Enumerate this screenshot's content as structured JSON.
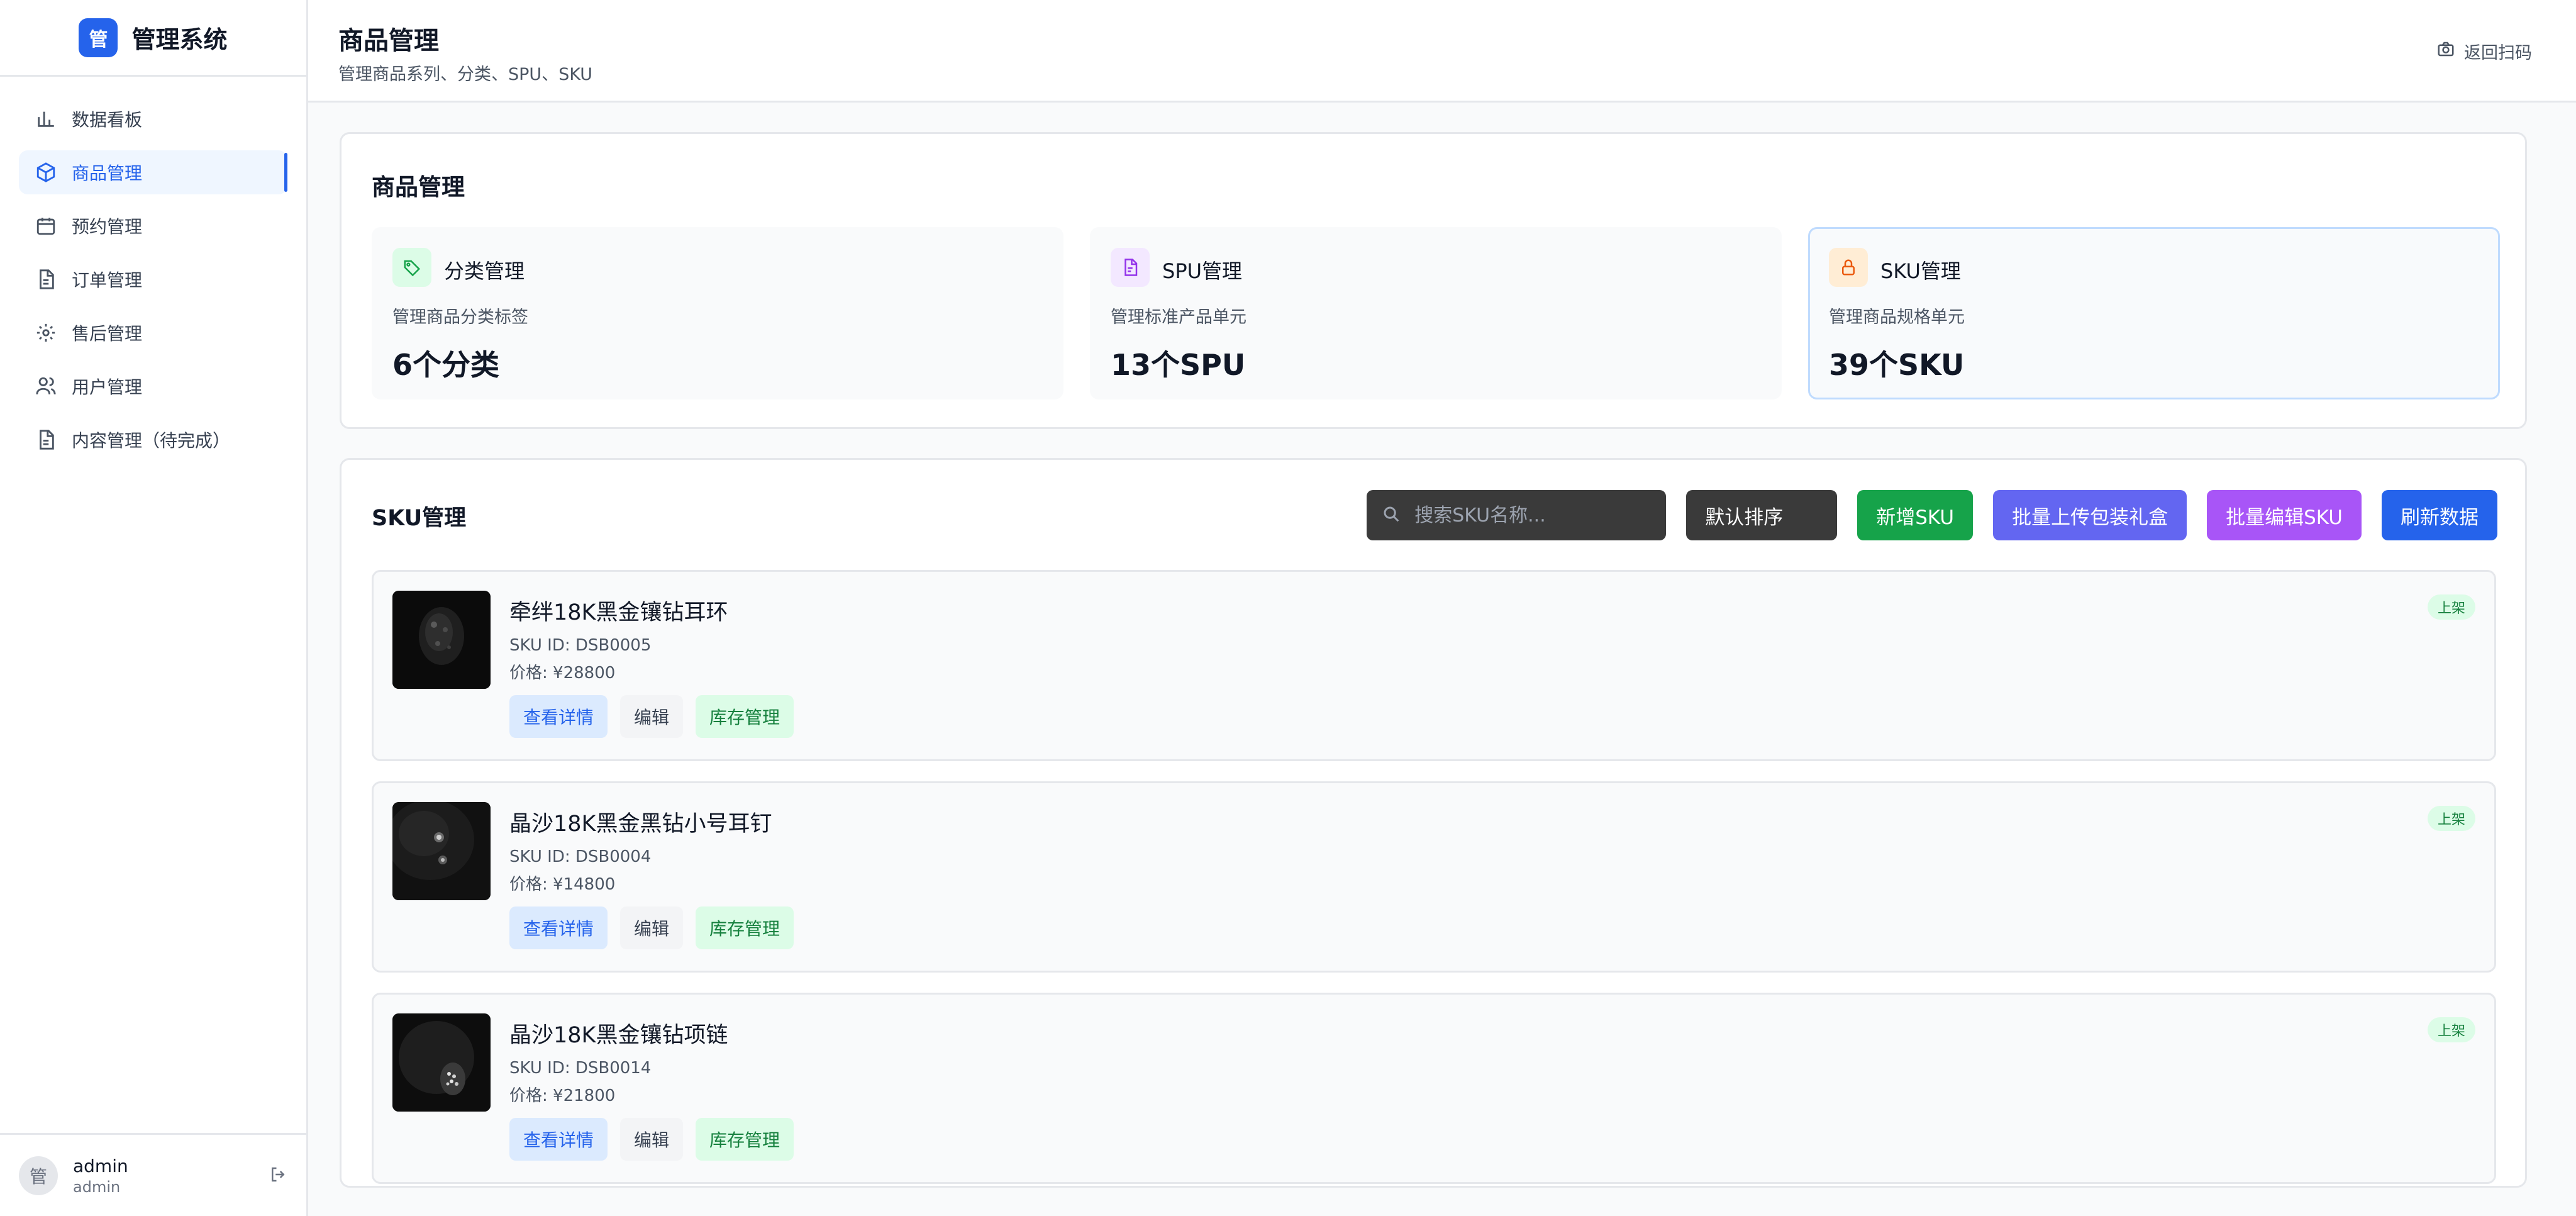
{
  "sidebar": {
    "brand_logo": "管",
    "brand_name": "管理系统",
    "items": [
      {
        "label": "数据看板",
        "icon": "bar-chart-icon"
      },
      {
        "label": "商品管理",
        "icon": "box-icon",
        "active": true
      },
      {
        "label": "预约管理",
        "icon": "calendar-icon"
      },
      {
        "label": "订单管理",
        "icon": "document-icon"
      },
      {
        "label": "售后管理",
        "icon": "gear-icon"
      },
      {
        "label": "用户管理",
        "icon": "users-icon"
      },
      {
        "label": "内容管理（待完成）",
        "icon": "document-icon"
      }
    ],
    "user": {
      "avatar": "管",
      "name": "admin",
      "role": "admin"
    }
  },
  "header": {
    "title": "商品管理",
    "subtitle": "管理商品系列、分类、SPU、SKU",
    "scan_label": "返回扫码"
  },
  "overview": {
    "title": "商品管理",
    "stats": [
      {
        "name": "分类管理",
        "desc": "管理商品分类标签",
        "value": "6个分类",
        "icon": "tag-icon",
        "icon_bg": "#dcfce7",
        "icon_color": "#16a34a"
      },
      {
        "name": "SPU管理",
        "desc": "管理标准产品单元",
        "value": "13个SPU",
        "icon": "file-icon",
        "icon_bg": "#f3e8ff",
        "icon_color": "#9333ea"
      },
      {
        "name": "SKU管理",
        "desc": "管理商品规格单元",
        "value": "39个SKU",
        "icon": "lock-icon",
        "icon_bg": "#ffedd5",
        "icon_color": "#ea580c"
      }
    ]
  },
  "sku_panel": {
    "title": "SKU管理",
    "search_placeholder": "搜索SKU名称...",
    "sort_label": "默认排序",
    "buttons": {
      "add": "新增SKU",
      "batch_upload": "批量上传包装礼盒",
      "batch_edit": "批量编辑SKU",
      "refresh": "刷新数据"
    },
    "items": [
      {
        "name": "牵绊18K黑金镶钻耳环",
        "sku_id": "SKU ID: DSB0005",
        "price": "价格: ¥28800",
        "status": "上架",
        "view": "查看详情",
        "edit": "编辑",
        "stock": "库存管理"
      },
      {
        "name": "晶沙18K黑金黑钻小号耳钉",
        "sku_id": "SKU ID: DSB0004",
        "price": "价格: ¥14800",
        "status": "上架",
        "view": "查看详情",
        "edit": "编辑",
        "stock": "库存管理"
      },
      {
        "name": "晶沙18K黑金镶钻项链",
        "sku_id": "SKU ID: DSB0014",
        "price": "价格: ¥21800",
        "status": "上架",
        "view": "查看详情",
        "edit": "编辑",
        "stock": "库存管理"
      }
    ]
  },
  "colors": {
    "accent": "#2563eb",
    "success": "#16a34a",
    "indigo": "#6366f1",
    "purple": "#a855f7"
  }
}
